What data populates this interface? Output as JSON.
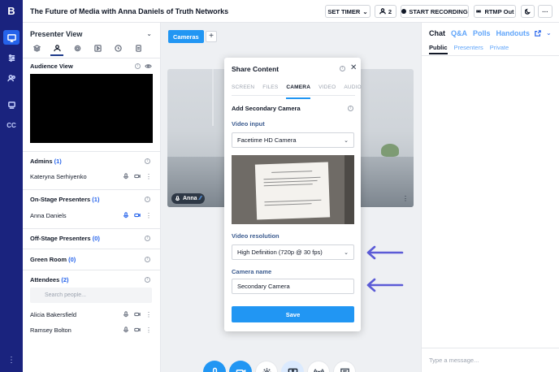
{
  "app": {
    "title": "The Future of Media with Anna Daniels of Truth Networks",
    "logo": "B"
  },
  "topbar": {
    "set_timer": "SET TIMER",
    "attendee_count": "2",
    "start_recording": "START RECORDING",
    "rtmp": "RTMP Out",
    "more": "···"
  },
  "rail": {
    "cc": "CC",
    "more": "⋮"
  },
  "presenter_panel": {
    "title": "Presenter View",
    "audience_view": "Audience View",
    "admins": {
      "label": "Admins",
      "count": "(1)",
      "people": [
        "Kateryna Serhiyenko"
      ]
    },
    "on_stage": {
      "label": "On-Stage Presenters",
      "count": "(1)",
      "people": [
        "Anna Daniels"
      ]
    },
    "off_stage": {
      "label": "Off-Stage Presenters",
      "count": "(0)"
    },
    "green_room": {
      "label": "Green Room",
      "count": "(0)"
    },
    "attendees": {
      "label": "Attendees",
      "count": "(2)",
      "people": [
        "Alicia Bakersfield",
        "Ramsey Bolton"
      ]
    },
    "search_placeholder": "Search people..."
  },
  "stage": {
    "tab_label": "Cameras",
    "add_label": "+",
    "presenter_name": "Anna"
  },
  "share_content": {
    "title": "Share Content",
    "tabs": [
      "SCREEN",
      "FILES",
      "CAMERA",
      "VIDEO",
      "AUDIO"
    ],
    "active_tab": "CAMERA",
    "subtitle": "Add Secondary Camera",
    "video_input_label": "Video input",
    "video_input_value": "Facetime HD Camera",
    "video_resolution_label": "Video resolution",
    "video_resolution_value": "High Definition (720p @ 30 fps)",
    "camera_name_label": "Camera name",
    "camera_name_value": "Secondary Camera",
    "save_label": "Save"
  },
  "chat_panel": {
    "tabs": [
      "Chat",
      "Q&A",
      "Polls",
      "Handouts"
    ],
    "sub_tabs": [
      "Public",
      "Presenters",
      "Private"
    ],
    "input_placeholder": "Type a message..."
  },
  "colors": {
    "rail_bg": "#1a237e",
    "accent_blue": "#2196f3",
    "annotation_arrow": "#5b5bd6"
  }
}
